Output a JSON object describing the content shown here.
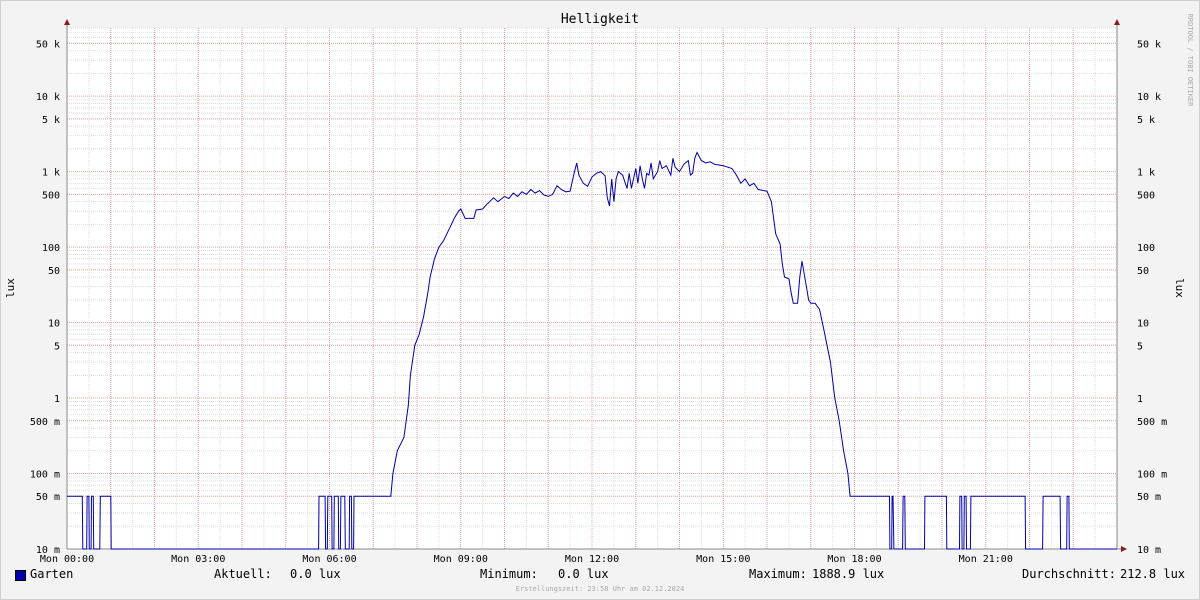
{
  "chart_data": {
    "type": "line",
    "title": "Helligkeit",
    "ylabel": "lux",
    "yscale": "log",
    "ylim": [
      0.01,
      80000
    ],
    "xlim_hours": [
      0,
      24
    ],
    "x_ticks": [
      {
        "h": 0,
        "label": "Mon 00:00"
      },
      {
        "h": 3,
        "label": "Mon 03:00"
      },
      {
        "h": 6,
        "label": "Mon 06:00"
      },
      {
        "h": 9,
        "label": "Mon 09:00"
      },
      {
        "h": 12,
        "label": "Mon 12:00"
      },
      {
        "h": 15,
        "label": "Mon 15:00"
      },
      {
        "h": 18,
        "label": "Mon 18:00"
      },
      {
        "h": 21,
        "label": "Mon 21:00"
      }
    ],
    "y_ticks": [
      {
        "v": 0.01,
        "label": "10 m"
      },
      {
        "v": 0.05,
        "label": "50 m"
      },
      {
        "v": 0.1,
        "label": "100 m"
      },
      {
        "v": 0.5,
        "label": "500 m"
      },
      {
        "v": 1,
        "label": "1"
      },
      {
        "v": 5,
        "label": "5"
      },
      {
        "v": 10,
        "label": "10"
      },
      {
        "v": 50,
        "label": "50"
      },
      {
        "v": 100,
        "label": "100"
      },
      {
        "v": 500,
        "label": "500"
      },
      {
        "v": 1000,
        "label": "1 k"
      },
      {
        "v": 5000,
        "label": "5 k"
      },
      {
        "v": 10000,
        "label": "10 k"
      },
      {
        "v": 50000,
        "label": "50 k"
      }
    ],
    "grid": true,
    "series": [
      {
        "name": "Garten",
        "color": "#0000aa",
        "points": [
          [
            0,
            0.05
          ],
          [
            0.35,
            0.05
          ],
          [
            0.36,
            0.01
          ],
          [
            0.45,
            0.01
          ],
          [
            0.46,
            0.05
          ],
          [
            0.5,
            0.05
          ],
          [
            0.51,
            0.01
          ],
          [
            0.55,
            0.01
          ],
          [
            0.56,
            0.05
          ],
          [
            0.6,
            0.05
          ],
          [
            0.61,
            0.01
          ],
          [
            0.75,
            0.01
          ],
          [
            0.76,
            0.05
          ],
          [
            1.0,
            0.05
          ],
          [
            1.01,
            0.01
          ],
          [
            5.75,
            0.01
          ],
          [
            5.76,
            0.05
          ],
          [
            5.9,
            0.05
          ],
          [
            5.91,
            0.01
          ],
          [
            5.95,
            0.01
          ],
          [
            5.96,
            0.05
          ],
          [
            6.05,
            0.05
          ],
          [
            6.06,
            0.01
          ],
          [
            6.1,
            0.01
          ],
          [
            6.11,
            0.05
          ],
          [
            6.2,
            0.05
          ],
          [
            6.21,
            0.01
          ],
          [
            6.25,
            0.01
          ],
          [
            6.26,
            0.05
          ],
          [
            6.35,
            0.05
          ],
          [
            6.36,
            0.01
          ],
          [
            6.45,
            0.01
          ],
          [
            6.46,
            0.05
          ],
          [
            6.5,
            0.05
          ],
          [
            6.51,
            0.01
          ],
          [
            6.5,
            0.01
          ],
          [
            6.55,
            0.01
          ],
          [
            6.56,
            0.05
          ],
          [
            7.4,
            0.05
          ],
          [
            7.45,
            0.1
          ],
          [
            7.55,
            0.2
          ],
          [
            7.7,
            0.3
          ],
          [
            7.8,
            0.8
          ],
          [
            7.85,
            2
          ],
          [
            7.95,
            5
          ],
          [
            8.05,
            7
          ],
          [
            8.15,
            12
          ],
          [
            8.25,
            25
          ],
          [
            8.3,
            40
          ],
          [
            8.4,
            70
          ],
          [
            8.5,
            100
          ],
          [
            8.6,
            120
          ],
          [
            8.75,
            180
          ],
          [
            8.85,
            240
          ],
          [
            8.95,
            300
          ],
          [
            9.0,
            320
          ],
          [
            9.05,
            280
          ],
          [
            9.1,
            240
          ],
          [
            9.3,
            240
          ],
          [
            9.35,
            310
          ],
          [
            9.5,
            320
          ],
          [
            9.6,
            370
          ],
          [
            9.75,
            450
          ],
          [
            9.85,
            400
          ],
          [
            10.0,
            470
          ],
          [
            10.1,
            440
          ],
          [
            10.2,
            520
          ],
          [
            10.3,
            470
          ],
          [
            10.4,
            540
          ],
          [
            10.5,
            500
          ],
          [
            10.6,
            580
          ],
          [
            10.7,
            520
          ],
          [
            10.8,
            560
          ],
          [
            10.9,
            490
          ],
          [
            11.0,
            470
          ],
          [
            11.1,
            500
          ],
          [
            11.2,
            650
          ],
          [
            11.3,
            580
          ],
          [
            11.4,
            540
          ],
          [
            11.5,
            550
          ],
          [
            11.6,
            1000
          ],
          [
            11.65,
            1300
          ],
          [
            11.7,
            900
          ],
          [
            11.8,
            700
          ],
          [
            11.9,
            640
          ],
          [
            12.0,
            850
          ],
          [
            12.1,
            950
          ],
          [
            12.2,
            1000
          ],
          [
            12.3,
            880
          ],
          [
            12.35,
            450
          ],
          [
            12.4,
            350
          ],
          [
            12.45,
            800
          ],
          [
            12.5,
            400
          ],
          [
            12.55,
            800
          ],
          [
            12.6,
            1000
          ],
          [
            12.7,
            900
          ],
          [
            12.8,
            600
          ],
          [
            12.85,
            950
          ],
          [
            12.9,
            600
          ],
          [
            13.0,
            1100
          ],
          [
            13.05,
            700
          ],
          [
            13.1,
            1200
          ],
          [
            13.15,
            800
          ],
          [
            13.2,
            600
          ],
          [
            13.25,
            950
          ],
          [
            13.3,
            900
          ],
          [
            13.35,
            1300
          ],
          [
            13.4,
            800
          ],
          [
            13.5,
            1000
          ],
          [
            13.55,
            1400
          ],
          [
            13.6,
            1100
          ],
          [
            13.7,
            1200
          ],
          [
            13.8,
            900
          ],
          [
            13.85,
            1500
          ],
          [
            13.9,
            1150
          ],
          [
            14.0,
            1000
          ],
          [
            14.1,
            1250
          ],
          [
            14.2,
            1400
          ],
          [
            14.25,
            900
          ],
          [
            14.3,
            950
          ],
          [
            14.35,
            1500
          ],
          [
            14.4,
            1800
          ],
          [
            14.5,
            1400
          ],
          [
            14.6,
            1300
          ],
          [
            14.7,
            1350
          ],
          [
            14.8,
            1250
          ],
          [
            15.0,
            1200
          ],
          [
            15.2,
            1100
          ],
          [
            15.3,
            900
          ],
          [
            15.4,
            700
          ],
          [
            15.5,
            800
          ],
          [
            15.6,
            650
          ],
          [
            15.7,
            700
          ],
          [
            15.8,
            580
          ],
          [
            16.0,
            550
          ],
          [
            16.1,
            400
          ],
          [
            16.2,
            150
          ],
          [
            16.3,
            110
          ],
          [
            16.35,
            60
          ],
          [
            16.4,
            40
          ],
          [
            16.5,
            38
          ],
          [
            16.55,
            25
          ],
          [
            16.6,
            18
          ],
          [
            16.7,
            18
          ],
          [
            16.75,
            40
          ],
          [
            16.8,
            65
          ],
          [
            16.9,
            30
          ],
          [
            16.95,
            20
          ],
          [
            17.0,
            18
          ],
          [
            17.1,
            18
          ],
          [
            17.2,
            15
          ],
          [
            17.3,
            8
          ],
          [
            17.45,
            3
          ],
          [
            17.55,
            1
          ],
          [
            17.65,
            0.5
          ],
          [
            17.75,
            0.2
          ],
          [
            17.85,
            0.1
          ],
          [
            17.9,
            0.05
          ],
          [
            18.8,
            0.05
          ],
          [
            18.81,
            0.01
          ],
          [
            18.85,
            0.01
          ],
          [
            18.86,
            0.05
          ],
          [
            18.88,
            0.05
          ],
          [
            18.9,
            0.01
          ],
          [
            19.1,
            0.01
          ],
          [
            19.11,
            0.05
          ],
          [
            19.15,
            0.05
          ],
          [
            19.16,
            0.01
          ],
          [
            19.6,
            0.01
          ],
          [
            19.61,
            0.05
          ],
          [
            20.1,
            0.05
          ],
          [
            20.11,
            0.01
          ],
          [
            20.4,
            0.01
          ],
          [
            20.41,
            0.05
          ],
          [
            20.45,
            0.05
          ],
          [
            20.46,
            0.01
          ],
          [
            20.5,
            0.01
          ],
          [
            20.51,
            0.05
          ],
          [
            20.55,
            0.05
          ],
          [
            20.56,
            0.01
          ],
          [
            20.65,
            0.01
          ],
          [
            20.66,
            0.05
          ],
          [
            21.9,
            0.05
          ],
          [
            21.91,
            0.01
          ],
          [
            22.3,
            0.01
          ],
          [
            22.31,
            0.05
          ],
          [
            22.7,
            0.05
          ],
          [
            22.71,
            0.01
          ],
          [
            22.85,
            0.01
          ],
          [
            22.86,
            0.05
          ],
          [
            22.9,
            0.05
          ],
          [
            22.91,
            0.01
          ],
          [
            24.0,
            0.01
          ]
        ]
      }
    ]
  },
  "credit": "RRDTOOL / TOBI OETIKER",
  "legend": {
    "series_name": "Garten",
    "current_label": "Aktuell:",
    "current_value": "0.0 lux",
    "min_label": "Minimum:",
    "min_value": "0.0 lux",
    "max_label": "Maximum:",
    "max_value": "1888.9 lux",
    "avg_label": "Durchschnitt:",
    "avg_value": "212.8 lux"
  },
  "footer": "Erstellungszeit: 23:58 Uhr am 02.12.2024"
}
